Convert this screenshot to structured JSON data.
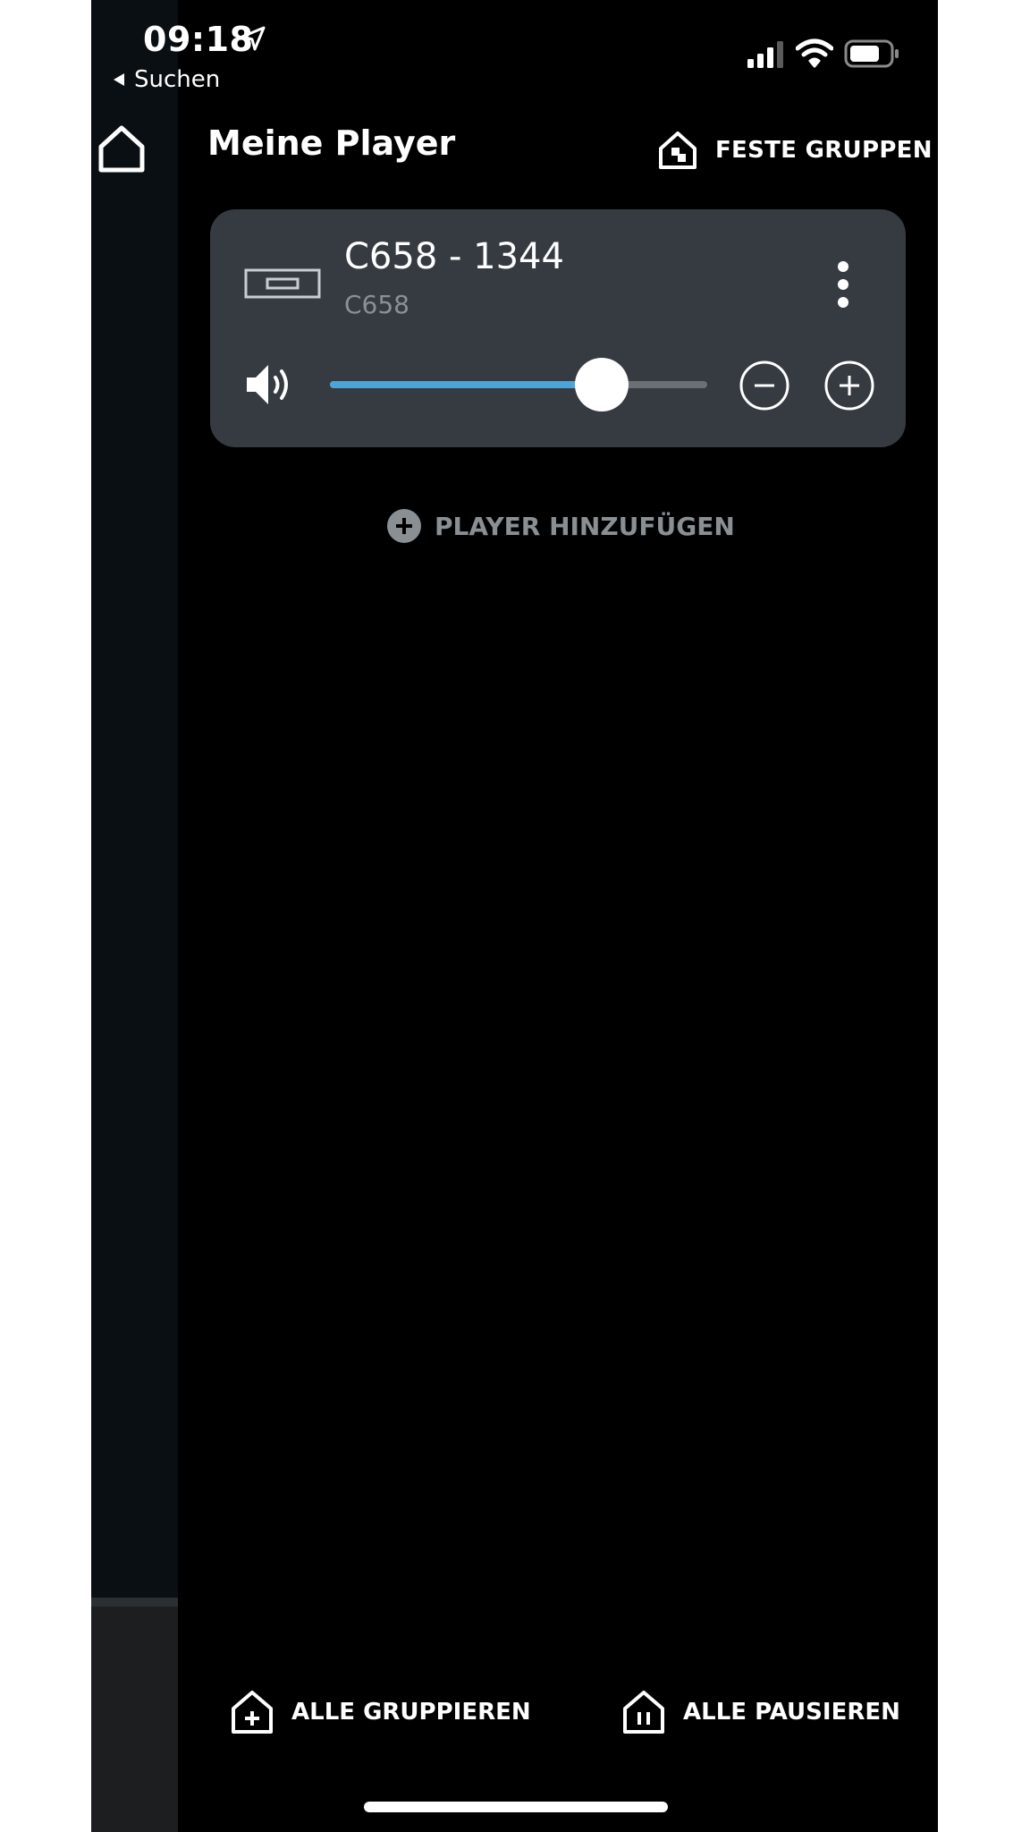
{
  "status_bar": {
    "time": "09:18",
    "back_label": "Suchen"
  },
  "header": {
    "title": "Meine Player",
    "fixed_groups_label": "FESTE GRUPPEN"
  },
  "player": {
    "name": "C658 - 1344",
    "model": "C658",
    "volume_percent": 72
  },
  "add_player_label": "PLAYER HINZUFÜGEN",
  "bottom_bar": {
    "group_all_label": "ALLE GRUPPIEREN",
    "pause_all_label": "ALLE PAUSIEREN"
  },
  "colors": {
    "accent": "#4ea3d8",
    "card_bg": "#353b41",
    "background": "#000000"
  },
  "icons": [
    "home-icon",
    "location-arrow-icon",
    "back-arrow-icon",
    "cellular-signal-icon",
    "wifi-icon",
    "battery-icon",
    "house-group-icon",
    "device-icon",
    "more-vertical-icon",
    "speaker-icon",
    "minus-circle-icon",
    "plus-circle-icon",
    "add-circle-icon",
    "house-plus-icon",
    "house-pause-icon"
  ]
}
